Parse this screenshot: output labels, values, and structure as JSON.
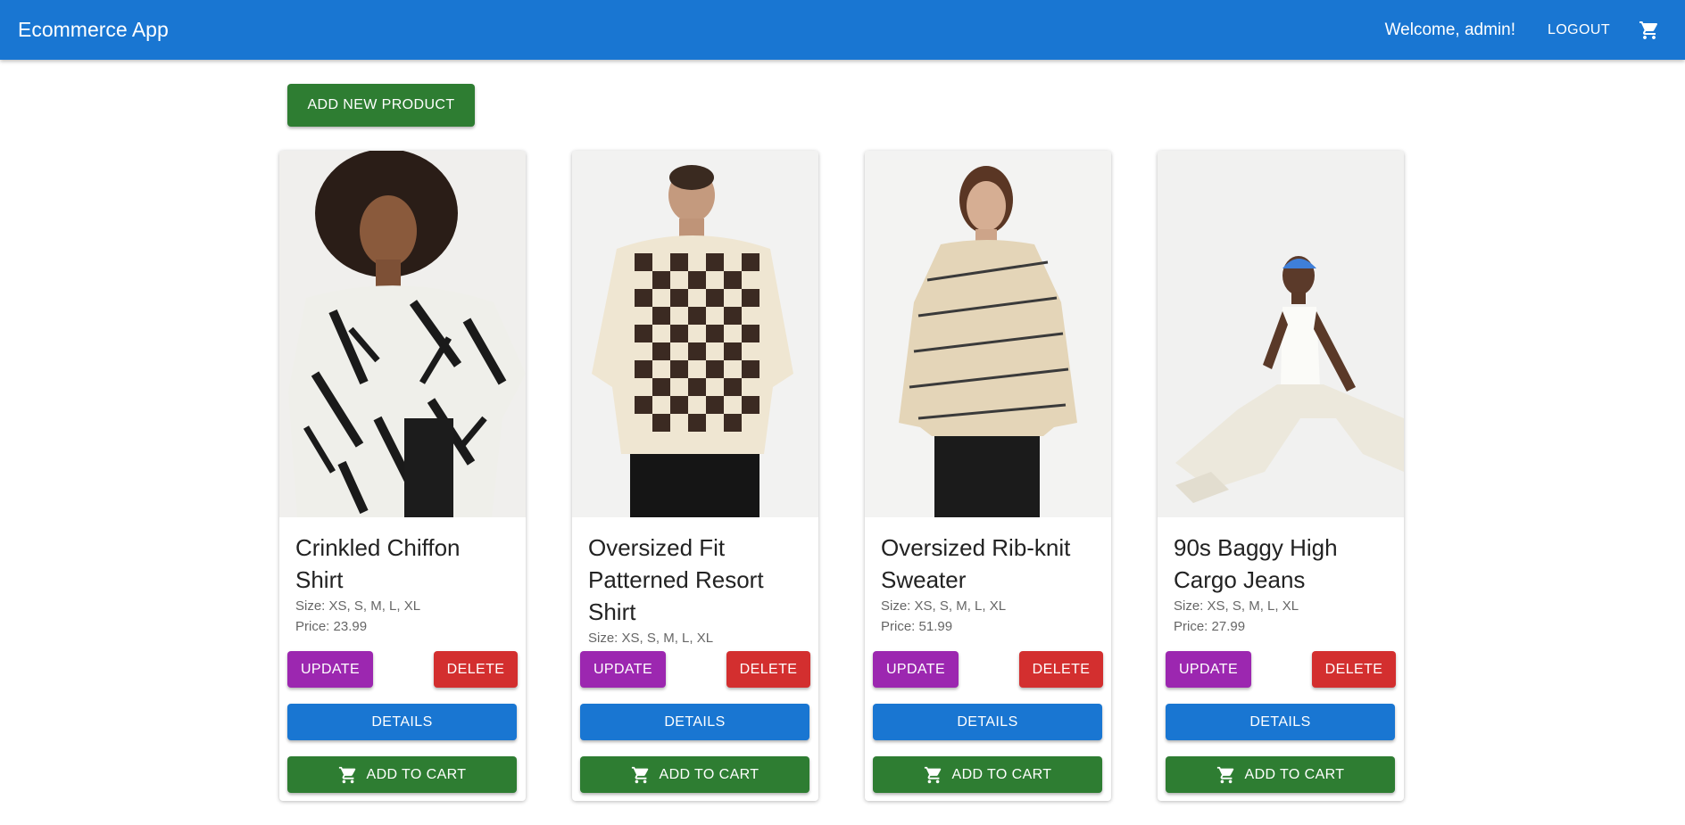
{
  "appbar": {
    "title": "Ecommerce App",
    "welcome": "Welcome, admin!",
    "logout_label": "LOGOUT",
    "cart_icon": "shopping-cart-icon",
    "background": "#1976d2"
  },
  "toolbar": {
    "add_product_label": "ADD NEW PRODUCT"
  },
  "colors": {
    "update": "#9c27b0",
    "delete": "#d32f2f",
    "details": "#1976d2",
    "add_to_cart": "#2e7d32"
  },
  "products": [
    {
      "name": "Crinkled Chiffon Shirt",
      "size": "Size: XS, S, M, L, XL",
      "price": "Price: 23.99",
      "update_label": "UPDATE",
      "delete_label": "DELETE",
      "details_label": "DETAILS",
      "add_to_cart_label": "ADD TO CART"
    },
    {
      "name": "Oversized Fit Patterned Resort Shirt",
      "size": "Size: XS, S, M, L, XL",
      "price": "",
      "update_label": "UPDATE",
      "delete_label": "DELETE",
      "details_label": "DETAILS",
      "add_to_cart_label": "ADD TO CART"
    },
    {
      "name": "Oversized Rib-knit Sweater",
      "size": "Size: XS, S, M, L, XL",
      "price": "Price: 51.99",
      "update_label": "UPDATE",
      "delete_label": "DELETE",
      "details_label": "DETAILS",
      "add_to_cart_label": "ADD TO CART"
    },
    {
      "name": "90s Baggy High Cargo Jeans",
      "size": "Size: XS, S, M, L, XL",
      "price": "Price: 27.99",
      "update_label": "UPDATE",
      "delete_label": "DELETE",
      "details_label": "DETAILS",
      "add_to_cart_label": "ADD TO CART"
    }
  ]
}
